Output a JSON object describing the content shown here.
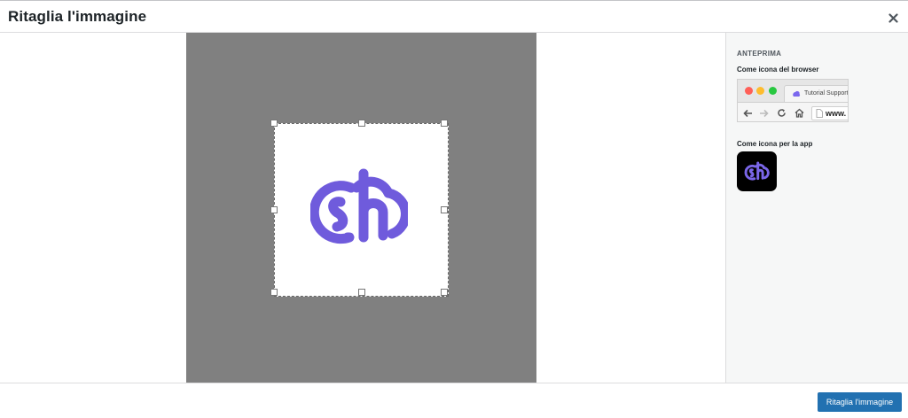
{
  "header": {
    "title": "Ritaglia l'immagine",
    "close_icon": "close-icon"
  },
  "crop": {
    "logo_icon": "cloud-sh-logo-icon",
    "logo_color": "#6c5ce7"
  },
  "preview": {
    "heading": "ANTEPRIMA",
    "browser_label": "Come icona del browser",
    "tab_title": "Tutorial Support",
    "url_text": "www.",
    "app_label": "Come icona per la app",
    "icons": [
      "back-arrow-icon",
      "forward-arrow-icon",
      "reload-icon",
      "home-icon",
      "page-icon"
    ]
  },
  "footer": {
    "crop_button_label": "Ritaglia l'immagine",
    "button_color": "#2271b1"
  }
}
